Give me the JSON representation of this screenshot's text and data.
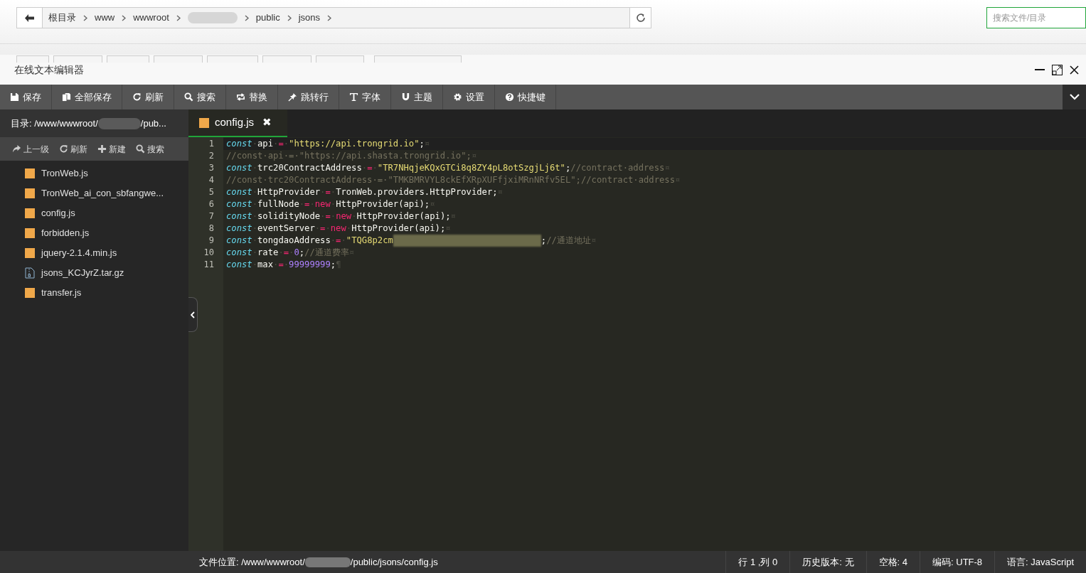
{
  "breadcrumb": {
    "items": [
      {
        "kind": "text",
        "label": "根目录"
      },
      {
        "kind": "text",
        "label": "www"
      },
      {
        "kind": "text",
        "label": "wwwroot"
      },
      {
        "kind": "redacted"
      },
      {
        "kind": "text",
        "label": "public"
      },
      {
        "kind": "text",
        "label": "jsons"
      }
    ]
  },
  "search": {
    "placeholder": "搜索文件/目录"
  },
  "window": {
    "title": "在线文本编辑器"
  },
  "toolbar": [
    {
      "kind": "save",
      "label": "保存"
    },
    {
      "kind": "copy",
      "label": "全部保存"
    },
    {
      "kind": "refresh",
      "label": "刷新"
    },
    {
      "kind": "search",
      "label": "搜索"
    },
    {
      "kind": "replace",
      "label": "替换"
    },
    {
      "kind": "pin",
      "label": "跳转行"
    },
    {
      "kind": "font",
      "label": "字体"
    },
    {
      "kind": "magnet",
      "label": "主题"
    },
    {
      "kind": "gear",
      "label": "设置"
    },
    {
      "kind": "help",
      "label": "快捷键"
    }
  ],
  "sidebar": {
    "path": [
      {
        "kind": "text",
        "label": "目录: /www/wwwroot/"
      },
      {
        "kind": "redacted"
      },
      {
        "kind": "text",
        "label": "/pub..."
      }
    ],
    "actions": [
      {
        "kind": "up",
        "label": "上一级"
      },
      {
        "kind": "refresh",
        "label": "刷新"
      },
      {
        "kind": "plus",
        "label": "新建"
      },
      {
        "kind": "search",
        "label": "搜索"
      }
    ],
    "files": [
      {
        "kind": "js",
        "name": "TronWeb.js"
      },
      {
        "kind": "js",
        "name": "TronWeb_ai_con_sbfangwe..."
      },
      {
        "kind": "js",
        "name": "config.js"
      },
      {
        "kind": "js",
        "name": "forbidden.js"
      },
      {
        "kind": "js",
        "name": "jquery-2.1.4.min.js"
      },
      {
        "kind": "archive",
        "name": "jsons_KCJyrZ.tar.gz"
      },
      {
        "kind": "js",
        "name": "transfer.js"
      }
    ]
  },
  "tabs": [
    {
      "name": "config.js",
      "close": "✖",
      "selected": true
    }
  ],
  "code": [
    {
      "number": "1",
      "tokens": [
        {
          "kind": "kw",
          "text": "const"
        },
        {
          "kind": "ws",
          "text": "·"
        },
        {
          "kind": "id",
          "text": "api"
        },
        {
          "kind": "ws",
          "text": "·"
        },
        {
          "kind": "op",
          "text": "="
        },
        {
          "kind": "ws",
          "text": "·"
        },
        {
          "kind": "str",
          "text": "\"https://api.trongrid.io\""
        },
        {
          "kind": "id",
          "text": ";"
        },
        {
          "kind": "ws",
          "text": "¤"
        }
      ]
    },
    {
      "number": "2",
      "tokens": [
        {
          "kind": "cm",
          "text": "//const·api·=·\"https://api.shasta.trongrid.io\";"
        },
        {
          "kind": "ws",
          "text": "¤"
        }
      ]
    },
    {
      "number": "3",
      "tokens": [
        {
          "kind": "kw",
          "text": "const"
        },
        {
          "kind": "ws",
          "text": "·"
        },
        {
          "kind": "id",
          "text": "trc20ContractAddress"
        },
        {
          "kind": "ws",
          "text": "·"
        },
        {
          "kind": "op",
          "text": "="
        },
        {
          "kind": "ws",
          "text": "·"
        },
        {
          "kind": "str",
          "text": "\"TR7NHqjeKQxGTCi8q8ZY4pL8otSzgjLj6t\""
        },
        {
          "kind": "id",
          "text": ";"
        },
        {
          "kind": "cm",
          "text": "//contract·address"
        },
        {
          "kind": "ws",
          "text": "¤"
        }
      ]
    },
    {
      "number": "4",
      "tokens": [
        {
          "kind": "cm",
          "text": "//const·trc20ContractAddress·=·\"TMKBMRVYL8ckEfXRpXUFfjxiMRnNRfv5EL\";//contract·address"
        },
        {
          "kind": "ws",
          "text": "¤"
        }
      ]
    },
    {
      "number": "5",
      "tokens": [
        {
          "kind": "kw",
          "text": "const"
        },
        {
          "kind": "ws",
          "text": "·"
        },
        {
          "kind": "id",
          "text": "HttpProvider"
        },
        {
          "kind": "ws",
          "text": "·"
        },
        {
          "kind": "op",
          "text": "="
        },
        {
          "kind": "ws",
          "text": "·"
        },
        {
          "kind": "id",
          "text": "TronWeb.providers.HttpProvider;"
        },
        {
          "kind": "ws",
          "text": "¤"
        }
      ]
    },
    {
      "number": "6",
      "tokens": [
        {
          "kind": "kw",
          "text": "const"
        },
        {
          "kind": "ws",
          "text": "·"
        },
        {
          "kind": "id",
          "text": "fullNode"
        },
        {
          "kind": "ws",
          "text": "·"
        },
        {
          "kind": "op",
          "text": "="
        },
        {
          "kind": "ws",
          "text": "·"
        },
        {
          "kind": "op",
          "text": "new"
        },
        {
          "kind": "ws",
          "text": "·"
        },
        {
          "kind": "id",
          "text": "HttpProvider(api);"
        },
        {
          "kind": "ws",
          "text": "¤"
        }
      ]
    },
    {
      "number": "7",
      "tokens": [
        {
          "kind": "kw",
          "text": "const"
        },
        {
          "kind": "ws",
          "text": "·"
        },
        {
          "kind": "id",
          "text": "solidityNode"
        },
        {
          "kind": "ws",
          "text": "·"
        },
        {
          "kind": "op",
          "text": "="
        },
        {
          "kind": "ws",
          "text": "·"
        },
        {
          "kind": "op",
          "text": "new"
        },
        {
          "kind": "ws",
          "text": "·"
        },
        {
          "kind": "id",
          "text": "HttpProvider(api);"
        },
        {
          "kind": "ws",
          "text": "¤"
        }
      ]
    },
    {
      "number": "8",
      "tokens": [
        {
          "kind": "kw",
          "text": "const"
        },
        {
          "kind": "ws",
          "text": "·"
        },
        {
          "kind": "id",
          "text": "eventServer"
        },
        {
          "kind": "ws",
          "text": "·"
        },
        {
          "kind": "op",
          "text": "="
        },
        {
          "kind": "ws",
          "text": "·"
        },
        {
          "kind": "op",
          "text": "new"
        },
        {
          "kind": "ws",
          "text": "·"
        },
        {
          "kind": "id",
          "text": "HttpProvider(api);"
        },
        {
          "kind": "ws",
          "text": "¤"
        }
      ]
    },
    {
      "number": "9",
      "tokens": [
        {
          "kind": "kw",
          "text": "const"
        },
        {
          "kind": "ws",
          "text": "·"
        },
        {
          "kind": "id",
          "text": "tongdaoAddress"
        },
        {
          "kind": "ws",
          "text": "·"
        },
        {
          "kind": "op",
          "text": "="
        },
        {
          "kind": "ws",
          "text": "·"
        },
        {
          "kind": "str",
          "text": "\"TQG8p2cm"
        },
        {
          "kind": "redacted"
        },
        {
          "kind": "id",
          "text": ";"
        },
        {
          "kind": "cm",
          "text": "//通道地址"
        },
        {
          "kind": "ws",
          "text": "¤"
        }
      ]
    },
    {
      "number": "10",
      "tokens": [
        {
          "kind": "kw",
          "text": "const"
        },
        {
          "kind": "ws",
          "text": "·"
        },
        {
          "kind": "id",
          "text": "rate"
        },
        {
          "kind": "ws",
          "text": "·"
        },
        {
          "kind": "op",
          "text": "="
        },
        {
          "kind": "ws",
          "text": "·"
        },
        {
          "kind": "num",
          "text": "0"
        },
        {
          "kind": "id",
          "text": ";"
        },
        {
          "kind": "cm",
          "text": "//通道费率"
        },
        {
          "kind": "ws",
          "text": "¤"
        }
      ]
    },
    {
      "number": "11",
      "tokens": [
        {
          "kind": "kw",
          "text": "const"
        },
        {
          "kind": "ws",
          "text": "·"
        },
        {
          "kind": "id",
          "text": "max"
        },
        {
          "kind": "ws",
          "text": "·"
        },
        {
          "kind": "op",
          "text": "="
        },
        {
          "kind": "ws",
          "text": "·"
        },
        {
          "kind": "num",
          "text": "99999999"
        },
        {
          "kind": "id",
          "text": ";"
        },
        {
          "kind": "ws",
          "text": "¶"
        }
      ]
    }
  ],
  "status_bar": {
    "location": [
      {
        "kind": "text",
        "label": "文件位置: /www/wwwroot/"
      },
      {
        "kind": "redacted"
      },
      {
        "kind": "text",
        "label": "/public/jsons/config.js"
      }
    ],
    "items": [
      "行 1 ,列 0",
      "历史版本: 无",
      "空格: 4",
      "编码: UTF-8",
      "语言: JavaScript"
    ]
  }
}
